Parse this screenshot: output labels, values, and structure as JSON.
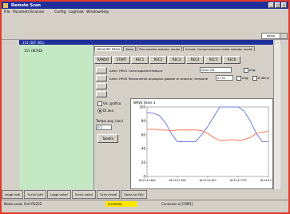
{
  "window": {
    "title": "Remote Scan"
  },
  "menu": [
    "File",
    "Parametri",
    "Scansei",
    "Config",
    "Loghook",
    "Window",
    "Help"
  ],
  "toolbar": {
    "field_label": "basso"
  },
  "mdi": {
    "title": "151 (DIT 361)"
  },
  "tree": {
    "root": "151 (BCRD)"
  },
  "tabs": [
    "MEASURE MENU",
    "Wave",
    "Psicrometria metodo: media",
    "Inerzia: Compensazione media metodo: media"
  ],
  "subtabs": [
    "RANDO",
    "START",
    "REC1",
    "REC2",
    "REC3",
    "REC4",
    "REC5",
    "REC6"
  ],
  "rows": [
    {
      "label": "Ambi.   HR01 Carro apparecchiatura",
      "field": "Drive Off",
      "check_a": "Ang."
    },
    {
      "label": "Ambi.   HR05 Rilevamento analogico globale di velocita / tensione",
      "field": "0.751",
      "check_a": "Ang.",
      "check_b": "Endline"
    }
  ],
  "options": {
    "chk": "Vis. grafico",
    "radio": "Di ana"
  },
  "tempo": {
    "label": "Tempo acq. (sec)",
    "value": "0.1"
  },
  "tabella_label": "Tabella",
  "chart_data": {
    "type": "line",
    "title": "WAVE Valve 1",
    "yticks": [
      100,
      80,
      60,
      40,
      20,
      0
    ],
    "xticks": [
      "18:22:20.840",
      "18:22:57.930",
      "18:22:24.810",
      "18:22:47.370",
      "18:24:47.650"
    ],
    "series": [
      {
        "color": "#6f7fe0",
        "values": [
          92,
          91,
          88,
          78,
          62,
          50,
          50,
          50,
          50,
          60,
          72,
          86,
          100,
          100,
          100,
          100,
          94,
          80,
          62,
          50,
          50
        ]
      },
      {
        "color": "#ff7a59",
        "values": [
          68,
          68,
          67,
          67,
          66,
          67,
          67,
          67,
          67,
          66,
          62,
          56,
          52,
          52,
          53,
          52,
          53,
          56,
          62,
          64,
          65
        ]
      }
    ]
  },
  "bottom_tabs": [
    "Leggi tutti",
    "Scrivi tutti",
    "Leggi valori",
    "Scrivi valori",
    "Scrivi modi",
    "Salva su EEp"
  ],
  "status": {
    "left": "Mode Local, Port RS232",
    "yellow": "FLIPSERA",
    "right": "Connesso a [COM1]"
  }
}
